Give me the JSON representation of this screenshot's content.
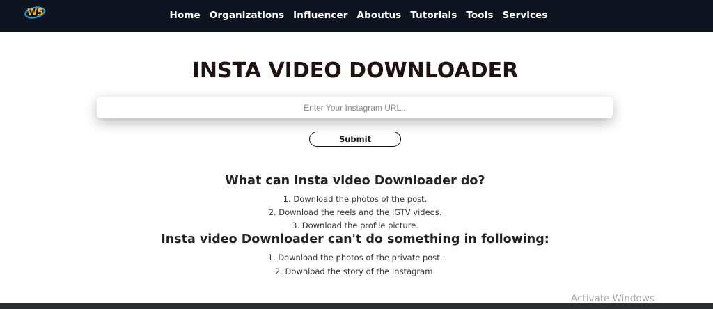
{
  "nav": {
    "logo_icon": "w5-logo-icon",
    "links": [
      "Home",
      "Organizations",
      "Influencer",
      "Aboutus",
      "Tutorials",
      "Tools",
      "Services"
    ]
  },
  "main": {
    "title": "INSTA VIDEO DOWNLOADER",
    "url_placeholder": "Enter Your Instagram URL..",
    "submit_label": "Submit"
  },
  "can_do": {
    "heading": "What can Insta video Downloader do?",
    "items": [
      "1. Download the photos of the post.",
      "2. Download the reels and the IGTV videos.",
      "3. Download the profile picture."
    ]
  },
  "cant_do": {
    "heading": "Insta video Downloader can't do something in following:",
    "items": [
      "1. Download the photos of the private post.",
      "2. Download the story of the Instagram."
    ]
  },
  "watermark": {
    "text": "Activate Windows"
  },
  "colors": {
    "navbar_bg": "#0e1420",
    "title_color": "#1e1311",
    "logo_yellow": "#f0b429",
    "logo_blue": "#2a9bd8"
  }
}
